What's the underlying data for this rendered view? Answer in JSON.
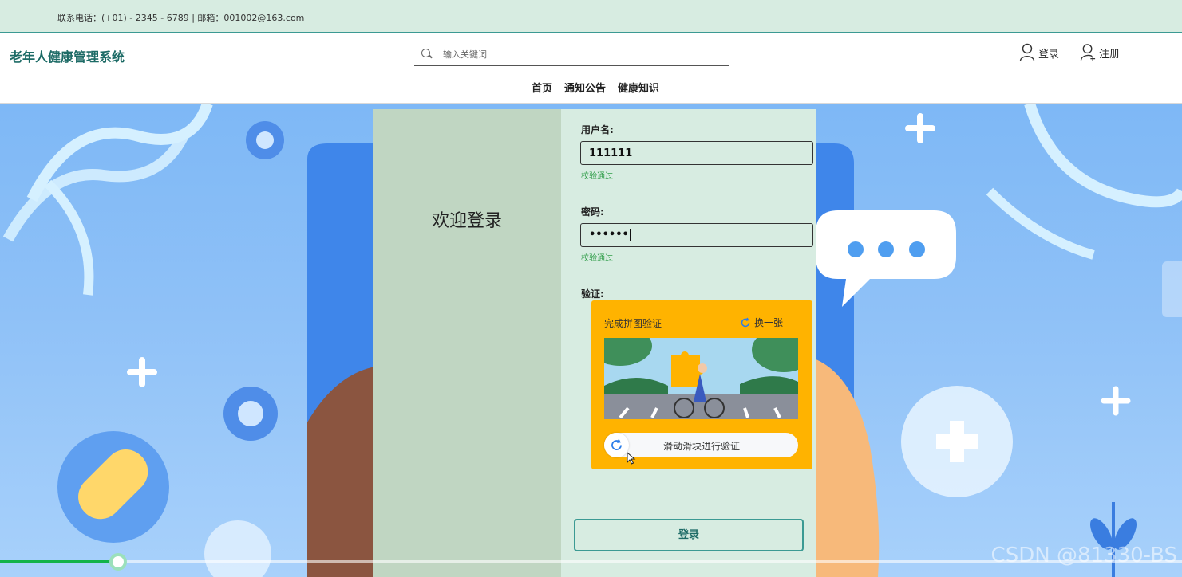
{
  "topbar": {
    "contact": "联系电话：(+01) - 2345 - 6789 | 邮箱：001002@163.com"
  },
  "header": {
    "brand": "老年人健康管理系统",
    "search_placeholder": "输入关键词",
    "login": "登录",
    "register": "注册"
  },
  "nav": [
    "首页",
    "通知公告",
    "健康知识"
  ],
  "login_panel": {
    "welcome": "欢迎登录",
    "username_label": "用户名:",
    "username_value": "111111",
    "username_status": "校验通过",
    "password_label": "密码:",
    "password_value": "••••••",
    "password_status": "校验通过",
    "verify_label": "验证:",
    "captcha": {
      "title": "完成拼图验证",
      "refresh": "换一张",
      "slider_text": "滑动滑块进行验证"
    },
    "login_button": "登录"
  },
  "video": {
    "progress_fraction": 0.1
  },
  "watermark": "CSDN @81330-BS",
  "colors": {
    "accent": "#1d6b66",
    "success": "#2f9d48",
    "captcha_bg": "#ffb300",
    "progress": "#12b34a"
  },
  "icons": [
    "search-icon",
    "user-icon",
    "user-add-icon",
    "refresh-icon",
    "cursor-icon"
  ]
}
